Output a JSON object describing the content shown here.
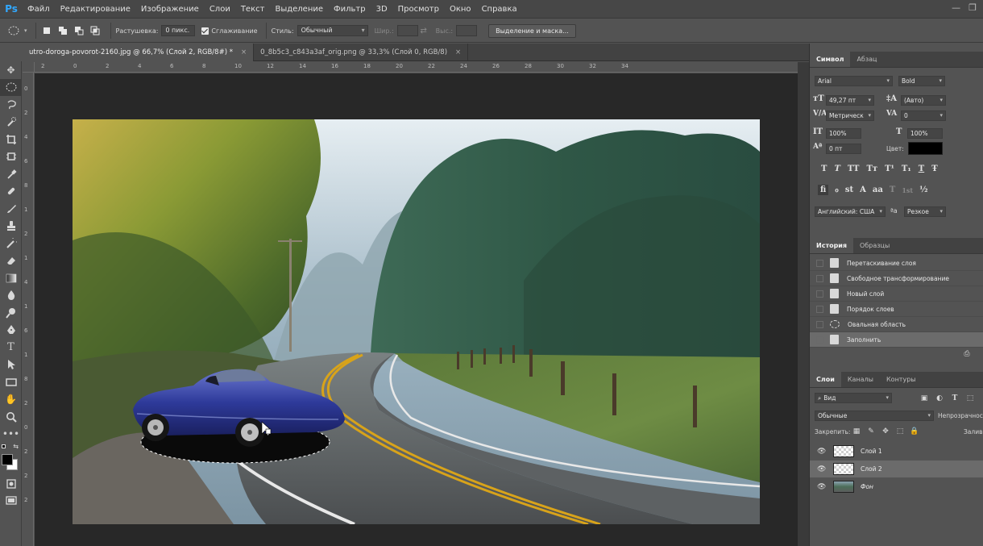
{
  "app": {
    "logo": "Ps"
  },
  "menu": [
    "Файл",
    "Редактирование",
    "Изображение",
    "Слои",
    "Текст",
    "Выделение",
    "Фильтр",
    "3D",
    "Просмотр",
    "Окно",
    "Справка"
  ],
  "window_controls": {
    "minimize": "—",
    "restore": "❐"
  },
  "options": {
    "feather_label": "Растушевка:",
    "feather_value": "0 пикс.",
    "antialias_label": "Сглаживание",
    "style_label": "Стиль:",
    "style_value": "Обычный",
    "width_label": "Шир.:",
    "height_label": "Выс.:",
    "select_mask_button": "Выделение и маска..."
  },
  "tabs": [
    {
      "label": "utro-doroga-povorot-2160.jpg @ 66,7% (Слой 2, RGB/8#) *",
      "close": "×"
    },
    {
      "label": "0_8b5c3_c843a3af_orig.png @ 33,3% (Слой 0, RGB/8)",
      "close": "×"
    }
  ],
  "ruler_h": [
    "2",
    "0",
    "2",
    "4",
    "6",
    "8",
    "10",
    "12",
    "14",
    "16",
    "18",
    "20",
    "22",
    "24",
    "26",
    "28",
    "30",
    "32",
    "34"
  ],
  "ruler_v": [
    "0",
    "2",
    "4",
    "6",
    "8",
    "1",
    "2",
    "1",
    "4",
    "1",
    "6",
    "1",
    "8",
    "2",
    "0",
    "2",
    "2",
    "2"
  ],
  "character_panel": {
    "tabs": [
      "Символ",
      "Абзац"
    ],
    "font_family": "Arial",
    "font_style": "Bold",
    "font_size": "49,27 пт",
    "leading": "(Авто)",
    "kerning": "Метрическ",
    "tracking": "0",
    "vertical_scale": "100%",
    "horizontal_scale": "100%",
    "baseline_shift": "0 пт",
    "color_label": "Цвет:",
    "color_value": "#000000",
    "style_buttons": [
      "T",
      "T",
      "TT",
      "Tт",
      "T¹",
      "T₁",
      "T",
      "Ŧ"
    ],
    "opentype_buttons": [
      "fi",
      "ℴ",
      "st",
      "A",
      "aa",
      "T",
      "1st",
      "½"
    ],
    "language": "Английский: США",
    "antialias_prefix": "ªa",
    "antialias": "Резкое"
  },
  "history_panel": {
    "tabs": [
      "История",
      "Образцы"
    ],
    "items": [
      "Перетаскивание слоя",
      "Свободное трансформирование",
      "Новый слой",
      "Порядок слоев",
      "Овальная область",
      "Заполнить"
    ],
    "selected_index": 5
  },
  "layers_panel": {
    "tabs": [
      "Слои",
      "Каналы",
      "Контуры"
    ],
    "filter": "Вид",
    "blend_mode": "Обычные",
    "opacity_label": "Непрозрачность",
    "lock_label": "Закрепить:",
    "fill_label": "Заливка",
    "layers": [
      {
        "name": "Слой 1",
        "type": "transparent"
      },
      {
        "name": "Слой 2",
        "type": "transparent",
        "selected": true
      },
      {
        "name": "Фон",
        "type": "photo"
      }
    ]
  },
  "colors": {
    "accent": "#31a8ff",
    "panel_bg": "#535353",
    "canvas_bg": "#282828",
    "selection": "#6b6b6b",
    "car_body": "#2e3a9a",
    "road_line": "#d8a31a"
  }
}
